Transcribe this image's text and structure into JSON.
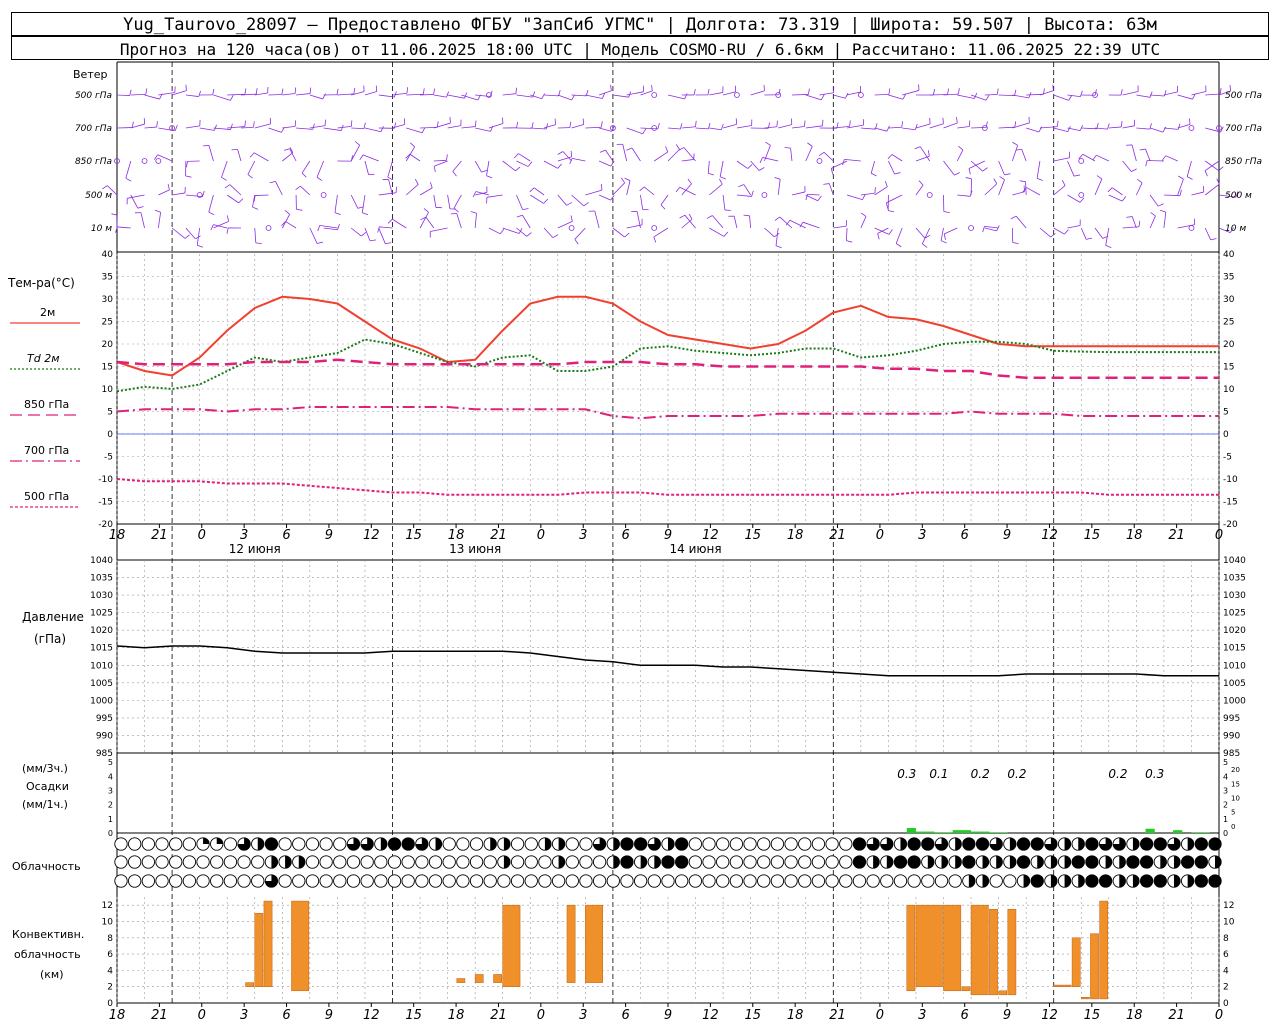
{
  "header": {
    "line1": "Yug_Taurovo_28097 – Предоставлено ФГБУ \"ЗапСиб УГМС\" | Долгота: 73.319 | Широта: 59.507 | Высота: 63м",
    "line2": "Прогноз на 120 часа(ов) от 11.06.2025 18:00 UTC  | Модель COSMO-RU / 6.6км | Рассчитано: 11.06.2025 22:39 UTC"
  },
  "colors": {
    "wind": "#8a2be2",
    "t2m": "#f04030",
    "td": "#1a7a1a",
    "t850": "#e0207a",
    "t700": "#e0207a",
    "t500": "#e0207a",
    "pressure": "#000000",
    "precip": "#22cc22",
    "conv": "#f0902a",
    "zero_line": "#3050ff"
  },
  "x_axis": {
    "hour_labels": [
      "18",
      "21",
      "0",
      "3",
      "6",
      "9",
      "12",
      "15",
      "18",
      "21",
      "0",
      "3",
      "6",
      "9",
      "12",
      "15",
      "18",
      "21",
      "0",
      "3",
      "6",
      "9",
      "12",
      "15",
      "18",
      "21",
      "0"
    ],
    "day_labels": [
      "12 июня",
      "13 июня",
      "14 июня"
    ]
  },
  "wind_panel": {
    "title": "Ветер",
    "levels": [
      "500 гПа",
      "700 гПа",
      "850 гПа",
      "500 м",
      "10 м"
    ]
  },
  "temp_panel": {
    "title": "Тем-ра(°С)",
    "legend": [
      {
        "label": "2м",
        "style": "solid"
      },
      {
        "label": "Td 2м",
        "style": "dotted"
      },
      {
        "label": "850 гПа",
        "style": "dashed"
      },
      {
        "label": "700 гПа",
        "style": "dashdot"
      },
      {
        "label": "500 гПа",
        "style": "dot"
      }
    ],
    "y_ticks": [
      "40",
      "35",
      "30",
      "25",
      "20",
      "15",
      "10",
      "5",
      "0",
      "-5",
      "-10",
      "-15",
      "-20"
    ]
  },
  "pressure_panel": {
    "title1": "Давление",
    "title2": "(гПа)",
    "y_ticks": [
      "1040",
      "1035",
      "1030",
      "1025",
      "1020",
      "1015",
      "1010",
      "1005",
      "1000",
      "995",
      "990",
      "985"
    ]
  },
  "precip_panel": {
    "title1": "(мм/3ч.)",
    "title2": "Осадки",
    "title3": "(мм/1ч.)",
    "y_ticks": [
      "5",
      "4",
      "3",
      "2",
      "1",
      "0"
    ],
    "y_ticks_right": [
      "5",
      "4",
      "3",
      "2",
      "1",
      "0"
    ],
    "y_ticks_right2": [
      "20",
      "15",
      "10",
      "5",
      "0"
    ],
    "annotations": [
      "0.3",
      "0.1",
      "0.2",
      "0.2",
      "0.2",
      "0.3"
    ]
  },
  "cloud_panel": {
    "title": "Облачность"
  },
  "conv_panel": {
    "title1": "Конвективн.",
    "title2": "облачность",
    "title3": "(км)",
    "y_ticks": [
      "12",
      "10",
      "8",
      "6",
      "4",
      "2",
      "0"
    ]
  },
  "chart_data": [
    {
      "type": "line",
      "name": "temperature",
      "x": [
        0,
        3,
        6,
        9,
        12,
        15,
        18,
        21,
        24,
        27,
        30,
        33,
        36,
        39,
        42,
        45,
        48,
        51,
        54,
        57,
        60,
        63,
        66,
        69,
        72,
        75,
        78,
        81,
        84,
        87,
        90,
        93,
        96,
        99,
        102,
        105,
        108,
        111,
        114,
        117,
        120
      ],
      "ylim": [
        -20,
        40
      ],
      "series": [
        {
          "name": "2м",
          "values": [
            16,
            14,
            13,
            17,
            23,
            28,
            30.5,
            30,
            29,
            25,
            21,
            19,
            16,
            16.5,
            23,
            29,
            30.5,
            30.5,
            29,
            25,
            22,
            21,
            20,
            19,
            20,
            23,
            27,
            28.5,
            26,
            25.5,
            24,
            22,
            20,
            19.5,
            19.5,
            19.5,
            19.5,
            19.5,
            19.5,
            19.5,
            19.5
          ]
        },
        {
          "name": "Td 2м",
          "values": [
            9.5,
            10.5,
            10,
            11,
            14,
            17,
            16,
            17,
            18,
            21,
            20,
            18,
            16,
            15,
            17,
            17.5,
            14,
            14,
            15,
            19,
            19.5,
            18.5,
            18,
            17.5,
            18,
            19,
            19,
            17,
            17.5,
            18.5,
            20,
            20.5,
            20.5,
            20,
            18.5,
            18.3,
            18.2,
            18.2,
            18.2,
            18.2,
            18.2
          ]
        },
        {
          "name": "850 гПа",
          "values": [
            16,
            15.5,
            15.5,
            15.5,
            15.5,
            16,
            16,
            16,
            16.5,
            16,
            15.5,
            15.5,
            15.5,
            15.5,
            15.5,
            15.5,
            15.5,
            16,
            16,
            16,
            15.5,
            15.5,
            15,
            15,
            15,
            15,
            15,
            15,
            14.5,
            14.5,
            14,
            14,
            13,
            12.5,
            12.5,
            12.5,
            12.5,
            12.5,
            12.5,
            12.5,
            12.5
          ]
        },
        {
          "name": "700 гПа",
          "values": [
            5,
            5.5,
            5.5,
            5.5,
            5,
            5.5,
            5.5,
            6,
            6,
            6,
            6,
            6,
            6,
            5.5,
            5.5,
            5.5,
            5.5,
            5.5,
            4,
            3.5,
            4,
            4,
            4,
            4,
            4.5,
            4.5,
            4.5,
            4.5,
            4.5,
            4.5,
            4.5,
            5,
            4.5,
            4.5,
            4.5,
            4,
            4,
            4,
            4,
            4,
            4
          ]
        },
        {
          "name": "500 гПа",
          "values": [
            -10,
            -10.5,
            -10.5,
            -10.5,
            -11,
            -11,
            -11,
            -11.5,
            -12,
            -12.5,
            -13,
            -13,
            -13.5,
            -13.5,
            -13.5,
            -13.5,
            -13.5,
            -13,
            -13,
            -13,
            -13.5,
            -13.5,
            -13.5,
            -13.5,
            -13.5,
            -13.5,
            -13.5,
            -13.5,
            -13.5,
            -13,
            -13,
            -13,
            -13,
            -13,
            -13,
            -13,
            -13.5,
            -13.5,
            -13.5,
            -13.5,
            -13.5
          ]
        }
      ]
    },
    {
      "type": "line",
      "name": "pressure",
      "x": [
        0,
        3,
        6,
        9,
        12,
        15,
        18,
        21,
        24,
        27,
        30,
        33,
        36,
        39,
        42,
        45,
        48,
        51,
        54,
        57,
        60,
        63,
        66,
        69,
        72,
        75,
        78,
        81,
        84,
        87,
        90,
        93,
        96,
        99,
        102,
        105,
        108,
        111,
        114,
        117,
        120
      ],
      "ylim": [
        985,
        1040
      ],
      "series": [
        {
          "values": [
            1015.5,
            1015,
            1015.5,
            1015.5,
            1015,
            1014,
            1013.5,
            1013.5,
            1013.5,
            1013.5,
            1014,
            1014,
            1014,
            1014,
            1014,
            1013.5,
            1012.5,
            1011.5,
            1011,
            1010,
            1010,
            1010,
            1009.5,
            1009.5,
            1009,
            1008.5,
            1008,
            1007.5,
            1007,
            1007,
            1007,
            1007,
            1007,
            1007.5,
            1007.5,
            1007.5,
            1007.5,
            1007.5,
            1007,
            1007,
            1007
          ]
        }
      ]
    },
    {
      "type": "bar",
      "name": "precipitation",
      "ylim": [
        0,
        5
      ],
      "bars": [
        {
          "x": 86,
          "w": 1,
          "value": 0.35
        },
        {
          "x": 87,
          "w": 2,
          "value": 0.1
        },
        {
          "x": 89,
          "w": 2,
          "value": 0.05
        },
        {
          "x": 91,
          "w": 2,
          "value": 0.2
        },
        {
          "x": 93,
          "w": 2,
          "value": 0.1
        },
        {
          "x": 95,
          "w": 2,
          "value": 0.05
        },
        {
          "x": 112,
          "w": 1,
          "value": 0.3
        },
        {
          "x": 115,
          "w": 1,
          "value": 0.2
        },
        {
          "x": 117,
          "w": 2,
          "value": 0.05
        }
      ]
    },
    {
      "type": "bar",
      "name": "convective_clouds",
      "ylim": [
        0,
        13
      ],
      "bars": [
        {
          "x": 14,
          "w": 1,
          "base": 2,
          "top": 2.5
        },
        {
          "x": 15,
          "w": 1,
          "base": 2,
          "top": 11
        },
        {
          "x": 16,
          "w": 1,
          "base": 2,
          "top": 12.5
        },
        {
          "x": 19,
          "w": 2,
          "base": 1.5,
          "top": 12.5
        },
        {
          "x": 37,
          "w": 1,
          "base": 2.5,
          "top": 3
        },
        {
          "x": 39,
          "w": 1,
          "base": 2.5,
          "top": 3.5
        },
        {
          "x": 41,
          "w": 1,
          "base": 2.5,
          "top": 3.5
        },
        {
          "x": 42,
          "w": 2,
          "base": 2,
          "top": 12
        },
        {
          "x": 49,
          "w": 1,
          "base": 2.5,
          "top": 12
        },
        {
          "x": 51,
          "w": 2,
          "base": 2.5,
          "top": 12
        },
        {
          "x": 86,
          "w": 1,
          "base": 1.5,
          "top": 12
        },
        {
          "x": 87,
          "w": 3,
          "base": 2,
          "top": 12
        },
        {
          "x": 90,
          "w": 2,
          "base": 1.5,
          "top": 12
        },
        {
          "x": 92,
          "w": 1,
          "base": 1.5,
          "top": 2
        },
        {
          "x": 93,
          "w": 2,
          "base": 1,
          "top": 12
        },
        {
          "x": 95,
          "w": 1,
          "base": 1,
          "top": 11.5
        },
        {
          "x": 96,
          "w": 1,
          "base": 1,
          "top": 1.5
        },
        {
          "x": 97,
          "w": 1,
          "base": 1,
          "top": 11.5
        },
        {
          "x": 102,
          "w": 2,
          "base": 2,
          "top": 2.2
        },
        {
          "x": 104,
          "w": 1,
          "base": 2,
          "top": 8
        },
        {
          "x": 105,
          "w": 1,
          "base": 0.5,
          "top": 0.7
        },
        {
          "x": 106,
          "w": 1,
          "base": 0.5,
          "top": 8.5
        },
        {
          "x": 107,
          "w": 1,
          "base": 0.5,
          "top": 12.5
        }
      ]
    }
  ]
}
